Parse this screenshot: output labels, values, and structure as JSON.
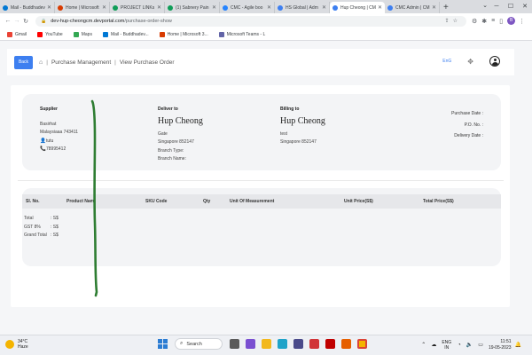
{
  "browser": {
    "tabs": [
      {
        "label": "Mail - Buddhadev",
        "color": "#0078d4"
      },
      {
        "label": "Home | Microsoft",
        "color": "#d83b01"
      },
      {
        "label": "PROJECT LINKs",
        "color": "#0f9d58"
      },
      {
        "label": "(1) Sabnery Pain",
        "color": "#0f9d58"
      },
      {
        "label": "CMC - Agile boo",
        "color": "#2684ff"
      },
      {
        "label": "HS Global | Adm",
        "color": "#3d7ff0"
      },
      {
        "label": "Hup Cheong | CM",
        "color": "#3d7ff0",
        "active": true
      },
      {
        "label": "CMC Admin | CM",
        "color": "#3d7ff0"
      }
    ],
    "address": {
      "domain": "dev-hup-cheongcm.devportal.com",
      "path": "/purchase-order-show"
    },
    "profile_initial": "B",
    "bookmarks": [
      {
        "label": "Gmail",
        "color": "#ea4335"
      },
      {
        "label": "YouTube",
        "color": "#ff0000"
      },
      {
        "label": "Maps",
        "color": "#34a853"
      },
      {
        "label": "Mail - Buddhadev...",
        "color": "#0078d4"
      },
      {
        "label": "Home | Microsoft 3...",
        "color": "#d83b01"
      },
      {
        "label": "Microsoft Teams - L",
        "color": "#6264a7"
      }
    ]
  },
  "app": {
    "back_label": "Back",
    "breadcrumb": [
      "Purchase Management",
      "View Purchase Order"
    ],
    "breadcrumb_sep": "|",
    "language": "EnG"
  },
  "supplier": {
    "title": "Supplier",
    "line1": "Basirhat",
    "line2": "Malaysiaaa 743411",
    "contact": "tutu",
    "phone": "78995412"
  },
  "deliver": {
    "title": "Deliver to",
    "name": "Hup Cheong",
    "line1": "Gate",
    "line2": "Singapore 852147",
    "branch_type": "Branch Type:",
    "branch_name": "Branch Name:"
  },
  "billing": {
    "title": "Billing to",
    "name": "Hup Cheong",
    "line1": "test",
    "line2": "Singapore 852147"
  },
  "order_meta": {
    "purchase_date": "Purchase Date :",
    "po_no": "P.O. No. :",
    "delivery_date": "Delivery Date :"
  },
  "table": {
    "headers": [
      "Sl. No.",
      "Product Nam",
      "SKU Code",
      "Qty",
      "Unit Of Measurement",
      "Unit Price(S$)",
      "Total Price(S$)"
    ]
  },
  "totals": [
    {
      "label": "Total",
      "value": ": S$"
    },
    {
      "label": "GST 8%",
      "value": ": S$"
    },
    {
      "label": "Grand Total",
      "value": ": S$"
    }
  ],
  "taskbar": {
    "weather_temp": "34°C",
    "weather_desc": "Haze",
    "search_label": "Search",
    "lang": "ENG",
    "region": "IN",
    "time": "11:51",
    "date": "19-05-2023"
  },
  "colors": {
    "accent": "#3d7ff0",
    "annotation": "#2e7d32"
  }
}
